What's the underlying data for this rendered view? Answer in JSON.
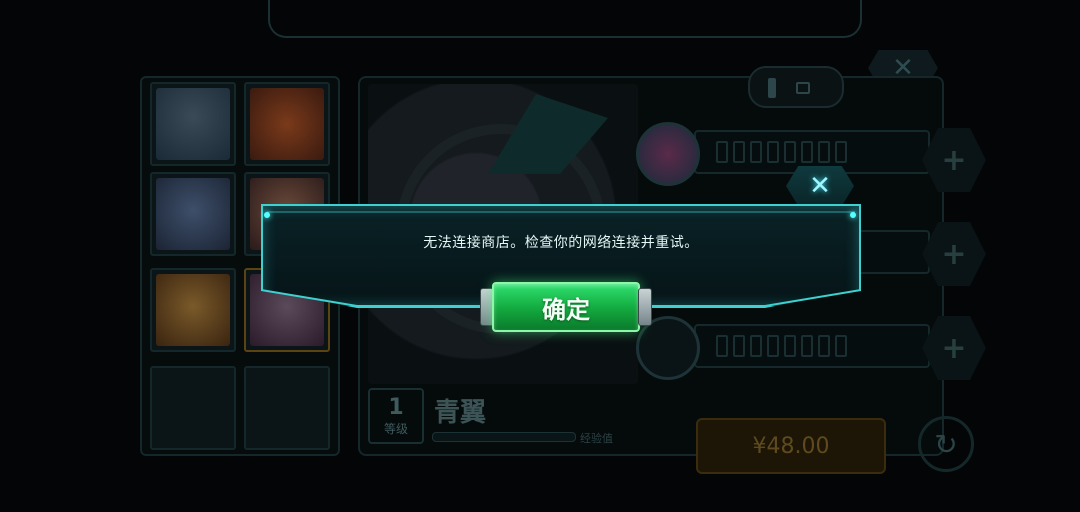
{
  "background": {
    "close_glyph": "✕",
    "plus_glyph": "+",
    "refresh_glyph": "↻",
    "hero": {
      "level_number": "1",
      "level_label": "等级",
      "name": "青翼",
      "exp_label": "经验值",
      "exp_progress": 0.0
    },
    "price": "¥48.00"
  },
  "dialog": {
    "close_glyph": "✕",
    "message": "无法连接商店。检查你的网络连接并重试。",
    "confirm_label": "确定"
  },
  "colors": {
    "accent_cyan": "#3fd0d0",
    "confirm_green": "#12a83e",
    "price_gold": "#5e4a1e"
  }
}
